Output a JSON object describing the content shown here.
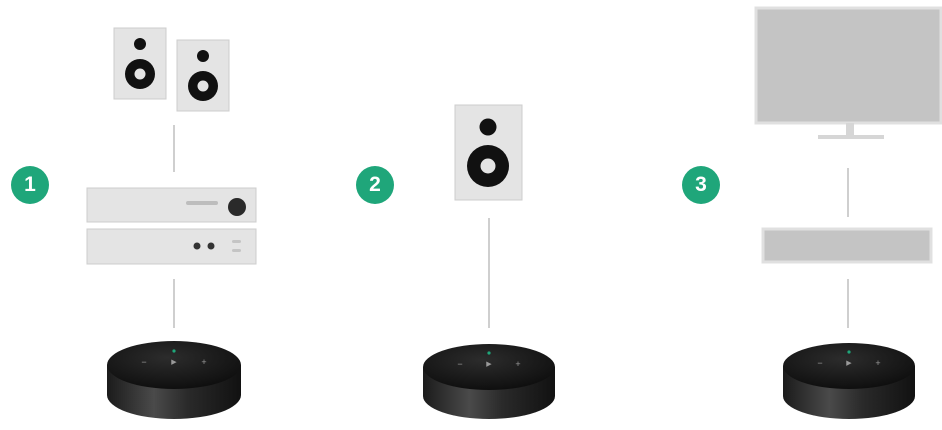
{
  "colors": {
    "badge": "#1fa67a",
    "device_fill": "#e4e4e4",
    "device_stroke": "#c9c9c9",
    "line": "#cfcfcf",
    "dark": "#111111"
  },
  "setups": [
    {
      "badge": "1",
      "devices": [
        "speaker-pair",
        "amplifier",
        "receiver",
        "remote-hub"
      ]
    },
    {
      "badge": "2",
      "devices": [
        "single-speaker",
        "remote-hub"
      ]
    },
    {
      "badge": "3",
      "devices": [
        "tv-monitor",
        "soundbar",
        "remote-hub"
      ]
    }
  ],
  "hub_controls": {
    "minus_symbol": "−",
    "play_symbol": "▶",
    "plus_symbol": "+"
  }
}
